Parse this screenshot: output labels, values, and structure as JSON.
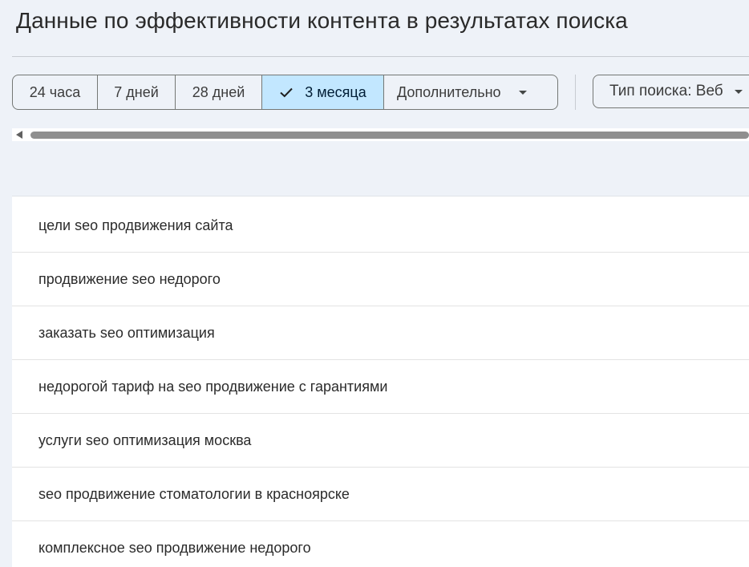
{
  "header": {
    "title": "Данные по эффективности контента в результатах поиска"
  },
  "date_filters": {
    "chips": [
      {
        "label": "24 часа",
        "selected": false
      },
      {
        "label": "7 дней",
        "selected": false
      },
      {
        "label": "28 дней",
        "selected": false
      },
      {
        "label": "3 месяца",
        "selected": true
      }
    ],
    "more_label": "Дополнительно"
  },
  "search_type": {
    "label": "Тип поиска: Веб"
  },
  "queries": [
    "цели seo продвижения сайта",
    "продвижение seo недорого",
    "заказать seo оптимизация",
    "недорогой тариф на seo продвижение с гарантиями",
    "услуги seo оптимизация москва",
    "seo продвижение стоматологии в красноярске",
    "комплексное seo продвижение недорого"
  ],
  "colors": {
    "background": "#eef2f8",
    "selected_chip": "#c2e7ff",
    "border": "#747775"
  }
}
